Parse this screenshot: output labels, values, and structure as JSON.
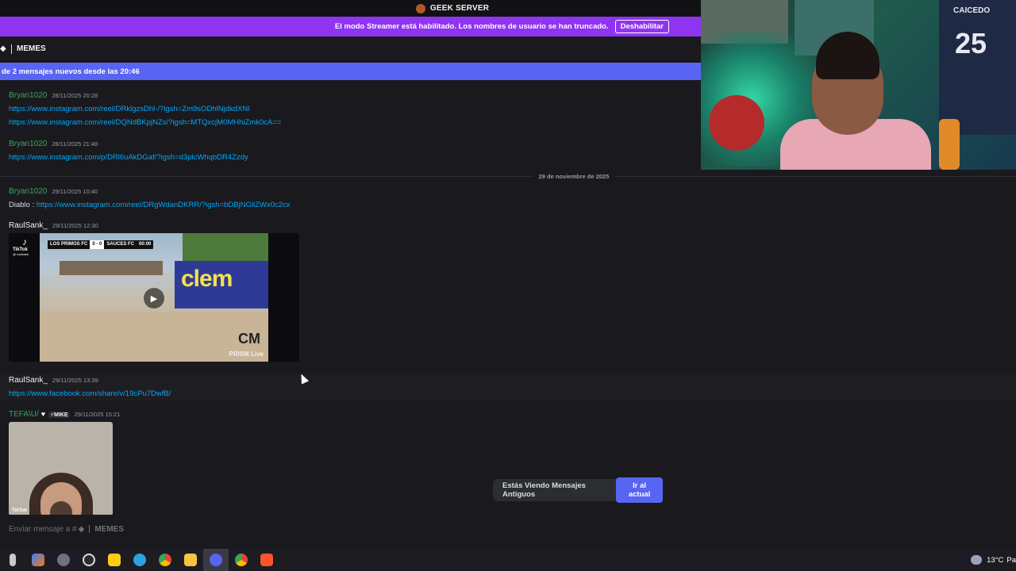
{
  "server": {
    "name": "GEEK SERVER"
  },
  "streamer_banner": {
    "message": "El modo Streamer está habilitado. Los nombres de usuario se han truncado.",
    "disable_label": "Deshabilitar"
  },
  "channel": {
    "name": "MEMES"
  },
  "new_messages_bar": {
    "text": "de 2 mensajes nuevos desde las 20:46"
  },
  "messages": [
    {
      "author": "Bryan1020",
      "timestamp": "28/11/2025 20:28",
      "lines": [
        "https://www.instagram.com/reel/DRklgzsDhl-/?igsh=Zm9sODhlNjdkdXNl",
        "https://www.instagram.com/reel/DQNdBKpjNZs/?igsh=MTQxcjM0MHhiZmk0cA=="
      ]
    },
    {
      "author": "Bryan1020",
      "timestamp": "28/11/2025 21:48",
      "lines": [
        "https://www.instagram.com/p/DRl6uAkDGaf/?igsh=d3plcWhqbDR4Zzdy"
      ]
    },
    {
      "author": "Bryan1020",
      "timestamp": "29/11/2025 10:40",
      "prefix": "Diablo :",
      "lines": [
        "https://www.instagram.com/reel/DRgWdanDKRR/?igsh=bDBjNGliZWx0c2cx"
      ]
    },
    {
      "author": "RaulSank_",
      "timestamp": "29/11/2025 12:30",
      "embed": {
        "tiktok_label": "TikTok",
        "tiktok_handle": "@ raulsank",
        "team_home": "LOS PRIMOS FC",
        "score": "0 - 0",
        "team_away": "SAUCES FC",
        "clock": "00:00",
        "banner_text": "clem",
        "watermark": "PRISM Live",
        "logo_text": "CM"
      }
    },
    {
      "author": "RaulSank_",
      "timestamp": "29/11/2025 13:39",
      "lines": [
        "https://www.facebook.com/share/v/19cPu7DwfB/"
      ]
    },
    {
      "author": "TEFA\\U/",
      "badge": "⚡MIKE",
      "timestamp": "29/11/2025 15:21",
      "embed": {
        "tiktok_label": "TikTok"
      }
    }
  ],
  "date_divider": "29 de noviembre de 2025",
  "jump_bar": {
    "text": "Estás Viendo Mensajes Antiguos",
    "button": "Ir al actual"
  },
  "composer": {
    "placeholder": "Enviar mensaje a #",
    "channel": "MEMES"
  },
  "taskbar": {
    "weather_temp": "13°C",
    "weather_more": "Pa"
  },
  "webcam": {
    "jersey_name": "CAICEDO",
    "jersey_number": "25"
  },
  "colors": {
    "streamer_bar": "#8f34f0",
    "new_messages_bar": "#5865f2",
    "link": "#00a8fc",
    "author_green": "#3ba55d",
    "background": "#1a1a1e"
  }
}
